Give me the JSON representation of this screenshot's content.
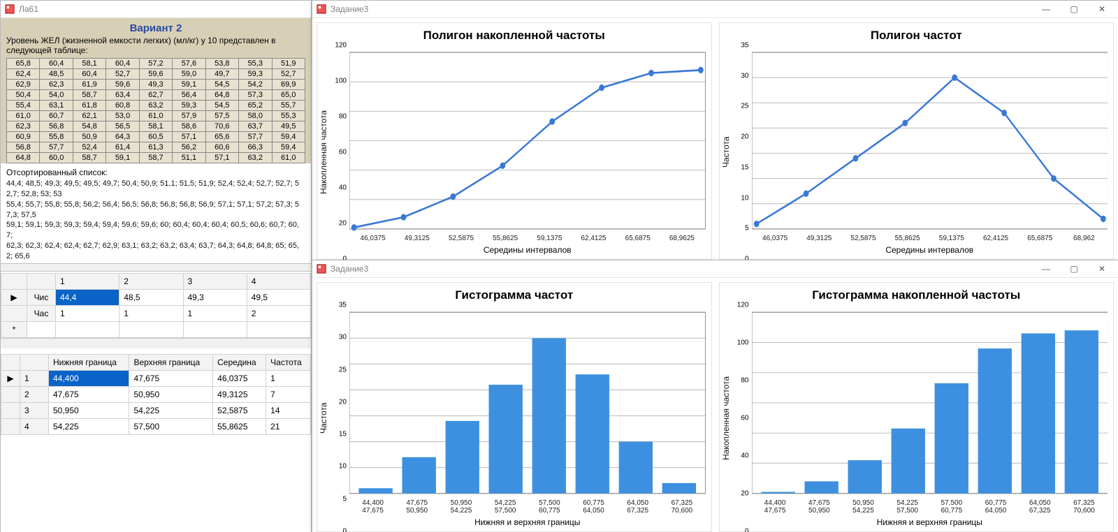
{
  "windows": {
    "left": {
      "title": "Ла61"
    },
    "topRight": {
      "title": "Задание3"
    },
    "bottomRight": {
      "title": "Задание3"
    }
  },
  "scan": {
    "title": "Вариант 2",
    "subtitle": "Уровень ЖЕЛ (жизненной емкости легких) (мл/кг) у 10 представлен в следующей таблице:",
    "rows": [
      [
        "65,8",
        "60,4",
        "58,1",
        "60,4",
        "57,2",
        "57,6",
        "53,8",
        "55,3",
        "51,9"
      ],
      [
        "62,4",
        "48,5",
        "60,4",
        "52,7",
        "59,6",
        "59,0",
        "49,7",
        "59,3",
        "52,7"
      ],
      [
        "62,9",
        "62,3",
        "61,9",
        "59,6",
        "49,3",
        "59,1",
        "54,5",
        "54,2",
        "69,9"
      ],
      [
        "50,4",
        "54,0",
        "58,7",
        "63,4",
        "62,7",
        "56,4",
        "64,8",
        "57,3",
        "65,0"
      ],
      [
        "55,4",
        "63,1",
        "61,8",
        "60,8",
        "63,2",
        "59,3",
        "54,5",
        "65,2",
        "55,7"
      ],
      [
        "61,0",
        "60,7",
        "62,1",
        "53,0",
        "61,0",
        "57,9",
        "57,5",
        "58,0",
        "55,3"
      ],
      [
        "62,3",
        "56,8",
        "54,8",
        "56,5",
        "58,1",
        "58,6",
        "70,6",
        "63,7",
        "49,5"
      ],
      [
        "60,9",
        "55,8",
        "50,9",
        "64,3",
        "60,5",
        "57,1",
        "65,6",
        "57,7",
        "59,4"
      ],
      [
        "56,8",
        "57,7",
        "52,4",
        "61,4",
        "61,3",
        "56,2",
        "60,6",
        "66,3",
        "59,4"
      ],
      [
        "64,8",
        "60,0",
        "58,7",
        "59,1",
        "58,7",
        "51,1",
        "57,1",
        "63,2",
        "61,0"
      ]
    ]
  },
  "sorted": {
    "heading": "Отсортированный список:",
    "lines": [
      "44,4; 48,5; 49,3; 49,5; 49,5; 49,7; 50,4; 50,9; 51,1; 51,5; 51,9; 52,4; 52,4; 52,7; 52,7; 52,7; 52,8; 53; 53",
      "55,4; 55,7; 55,8; 55,8; 56,2; 56,4; 56,5; 56,8; 56,8; 56,8; 56,9; 57,1; 57,1; 57,2; 57,3; 57,3; 57,5",
      "59,1; 59,1; 59,3; 59,3; 59,4; 59,4; 59,6; 59,6; 60; 60,4; 60,4; 60,4; 60,5; 60,6; 60,7; 60,7;",
      "62,3; 62,3; 62,4; 62,4; 62,7; 62,9; 63,1; 63,2; 63,2; 63,4; 63,7; 64,3; 64,8; 64,8; 65; 65,2; 65,6"
    ]
  },
  "grid1": {
    "headers": [
      "",
      "1",
      "2",
      "3",
      "4"
    ],
    "r1_label": "Чис",
    "r1": [
      "44,4",
      "48,5",
      "49,3",
      "49,5"
    ],
    "r2_label": "Час",
    "r2": [
      "1",
      "1",
      "1",
      "2"
    ]
  },
  "grid2": {
    "headers": [
      "",
      "Нижняя граница",
      "Верхняя граница",
      "Середина",
      "Частота"
    ],
    "rows": [
      [
        "1",
        "44,400",
        "47,675",
        "46,0375",
        "1"
      ],
      [
        "2",
        "47,675",
        "50,950",
        "49,3125",
        "7"
      ],
      [
        "3",
        "50,950",
        "54,225",
        "52,5875",
        "14"
      ],
      [
        "4",
        "54,225",
        "57,500",
        "55,8625",
        "21"
      ]
    ]
  },
  "chart_data": [
    {
      "id": "cumPoly",
      "title": "Полигон накопленной частоты",
      "type": "line",
      "xlabel": "Середины интервалов",
      "ylabel": "Накопленная частота",
      "categories": [
        "46,0375",
        "49,3125",
        "52,5875",
        "55,8625",
        "59,1375",
        "62,4125",
        "65,6875",
        "68,9625"
      ],
      "values": [
        1,
        8,
        22,
        43,
        73,
        96,
        106,
        108
      ],
      "ylim": [
        0,
        120
      ],
      "yTicks": [
        0,
        20,
        40,
        60,
        80,
        100,
        120
      ]
    },
    {
      "id": "freqPoly",
      "title": "Полигон частот",
      "type": "line",
      "xlabel": "Середины интервалов",
      "ylabel": "Частота",
      "categories": [
        "46,0375",
        "49,3125",
        "52,5875",
        "55,8625",
        "59,1375",
        "62,4125",
        "65,6875",
        "68,962"
      ],
      "values": [
        1,
        7,
        14,
        21,
        30,
        23,
        10,
        2
      ],
      "ylim": [
        0,
        35
      ],
      "yTicks": [
        0,
        5,
        10,
        15,
        20,
        25,
        30,
        35
      ]
    },
    {
      "id": "freqHist",
      "title": "Гистограмма частот",
      "type": "bar",
      "xlabel": "Нижняя и верхняя границы",
      "ylabel": "Частота",
      "categories": [
        "44,400\n47,675",
        "47,675\n50,950",
        "50,950\n54,225",
        "54,225\n57,500",
        "57,500\n60,775",
        "60,775\n64,050",
        "64,050\n67,325",
        "67,325\n70,600"
      ],
      "values": [
        1,
        7,
        14,
        21,
        30,
        23,
        10,
        2
      ],
      "ylim": [
        0,
        35
      ],
      "yTicks": [
        0,
        5,
        10,
        15,
        20,
        25,
        30,
        35
      ]
    },
    {
      "id": "cumHist",
      "title": "Гистограмма накопленной частоты",
      "type": "bar",
      "xlabel": "Нижняя и верхняя границы",
      "ylabel": "Накопленная частота",
      "categories": [
        "44,400\n47,675",
        "47,675\n50,950",
        "50,950\n54,225",
        "54,225\n57,500",
        "57,500\n60,775",
        "60,775\n64,050",
        "64,050\n67,325",
        "67,325\n70,600"
      ],
      "values": [
        1,
        8,
        22,
        43,
        73,
        96,
        106,
        108
      ],
      "ylim": [
        0,
        120
      ],
      "yTicks": [
        0,
        20,
        40,
        60,
        80,
        100,
        120
      ]
    }
  ]
}
